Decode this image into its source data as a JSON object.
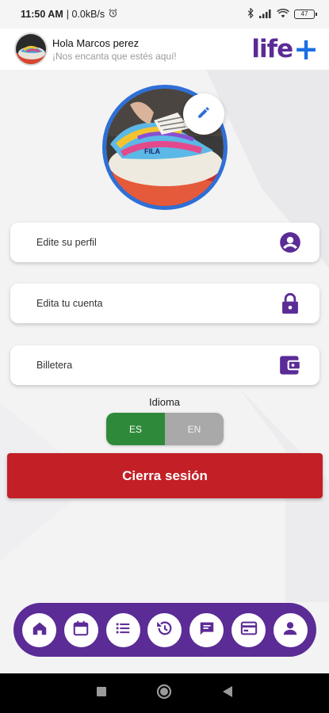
{
  "status_bar": {
    "time": "11:50 AM",
    "speed": "| 0.0kB/s",
    "battery": "47"
  },
  "header": {
    "greeting": "Hola Marcos perez",
    "subtitle": "¡Nos encanta que estés aquí!",
    "brand": "life",
    "brand_plus": "+"
  },
  "menu": [
    {
      "label": "Edite su perfil",
      "icon": "account-circle-icon"
    },
    {
      "label": "Edita tu cuenta",
      "icon": "lock-icon"
    },
    {
      "label": "Billetera",
      "icon": "wallet-icon"
    }
  ],
  "language": {
    "label": "Idioma",
    "options": [
      "ES",
      "EN"
    ],
    "selected": "ES"
  },
  "logout_label": "Cierra sesión",
  "bottom_nav": [
    {
      "icon": "home-icon"
    },
    {
      "icon": "calendar-icon"
    },
    {
      "icon": "list-icon"
    },
    {
      "icon": "history-icon"
    },
    {
      "icon": "chat-icon"
    },
    {
      "icon": "card-icon"
    },
    {
      "icon": "profile-icon"
    }
  ],
  "colors": {
    "brand_purple": "#5b2b96",
    "brand_blue": "#1b6fe3",
    "logout_red": "#c22026",
    "lang_active": "#2e8a3a",
    "lang_inactive": "#a9a9a9"
  }
}
